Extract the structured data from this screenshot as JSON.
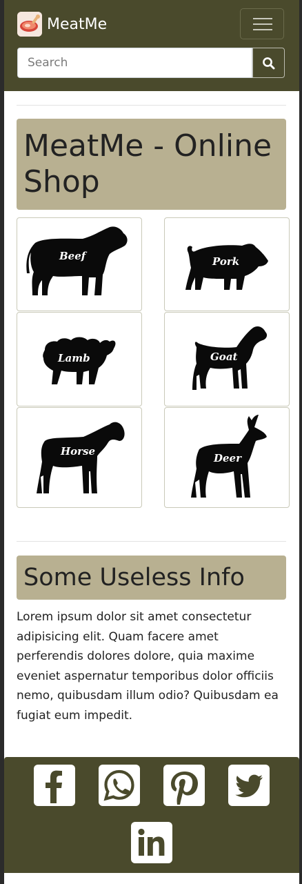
{
  "navbar": {
    "brand": "MeatMe",
    "search_placeholder": "Search",
    "logo_icon": "meat-logo-icon",
    "toggler_icon": "hamburger-menu-icon",
    "search_icon": "search-icon",
    "color": "#4a4a2c"
  },
  "shop": {
    "title": "MeatMe - Online Shop",
    "animals": [
      {
        "label": "Beef"
      },
      {
        "label": "Pork"
      },
      {
        "label": "Lamb"
      },
      {
        "label": "Goat"
      },
      {
        "label": "Horse"
      },
      {
        "label": "Deer"
      }
    ]
  },
  "info": {
    "title": "Some Useless Info",
    "text": "Lorem ipsum dolor sit amet consectetur adipisicing elit. Quam facere amet perferendis dolores dolore, quia maxime eveniet aspernatur temporibus dolor officiis nemo, quibusdam illum odio? Quibusdam ea fugiat eum impedit."
  },
  "footer": {
    "social": [
      "facebook-icon",
      "whatsapp-icon",
      "pinterest-icon",
      "twitter-icon",
      "linkedin-icon"
    ]
  },
  "colors": {
    "accent": "#b8b091",
    "dark": "#4a4a2c"
  }
}
